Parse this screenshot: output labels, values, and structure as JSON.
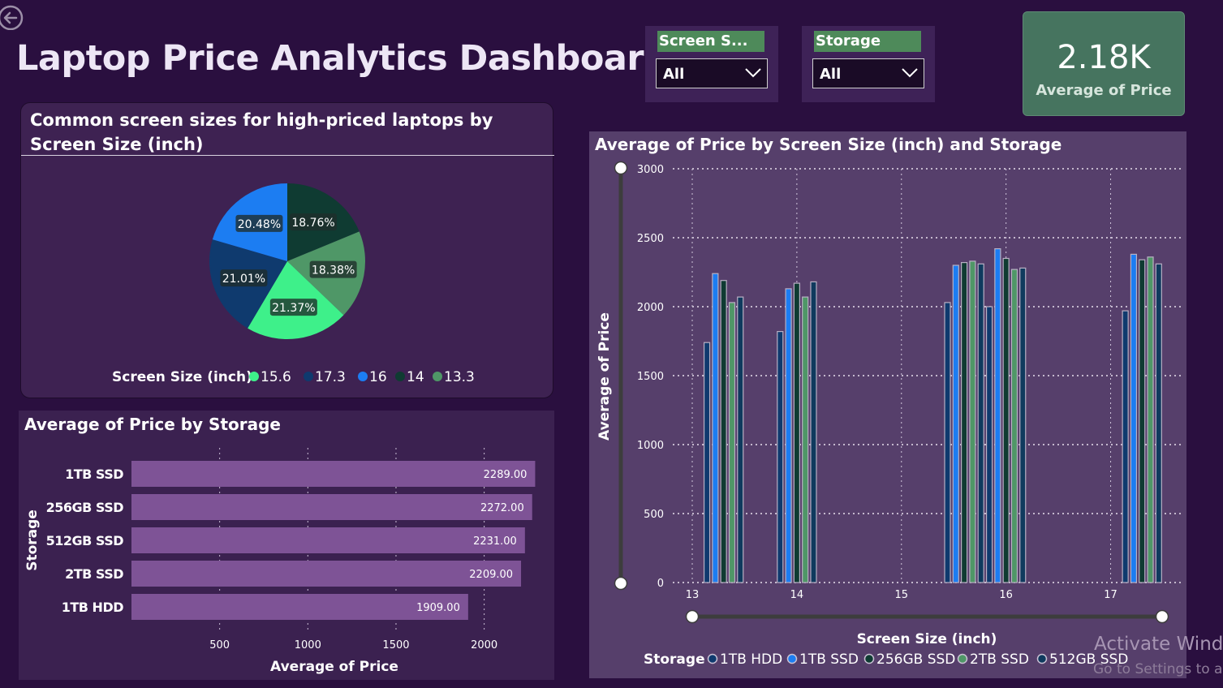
{
  "title": "Laptop Price Analytics Dashboard",
  "slicers": [
    {
      "label": "Screen S...",
      "value": "All"
    },
    {
      "label": "Storage",
      "value": "All"
    }
  ],
  "kpi": {
    "value": "2.18K",
    "label": "Average of Price"
  },
  "watermark": {
    "line1": "Activate Windo",
    "line2": "Go to Settings to ac"
  },
  "colors": {
    "15.6": "#3ef08a",
    "17.3": "#0f3a6e",
    "16": "#1c7df2",
    "14": "#0f3b32",
    "13.3": "#4f9767",
    "1TB HDD": "#0f3a6e",
    "1TB SSD": "#1c7df2",
    "256GB SSD": "#0f3b32",
    "2TB SSD": "#4f9767",
    "512GB SSD": "#0f3a5e",
    "storage_bar": "#7e5396"
  },
  "chart_data": [
    {
      "type": "pie",
      "title": "Common screen sizes for high-priced laptops by Screen Size (inch)",
      "legend_title": "Screen Size (inch)",
      "legend_position": "bottom",
      "slices": [
        {
          "name": "14",
          "value": 18.76,
          "label": "18.76%"
        },
        {
          "name": "13.3",
          "value": 18.38,
          "label": "18.38%"
        },
        {
          "name": "15.6",
          "value": 21.37,
          "label": "21.37%"
        },
        {
          "name": "17.3",
          "value": 21.01,
          "label": "21.01%"
        },
        {
          "name": "16",
          "value": 20.48,
          "label": "20.48%"
        }
      ],
      "legend_order": [
        "15.6",
        "17.3",
        "16",
        "14",
        "13.3"
      ]
    },
    {
      "type": "bar",
      "orientation": "horizontal",
      "title": "Average of Price by Storage",
      "xlabel": "Average of Price",
      "ylabel": "Storage",
      "categories": [
        "1TB SSD",
        "256GB SSD",
        "512GB SSD",
        "2TB SSD",
        "1TB HDD"
      ],
      "values": [
        2289.0,
        2272.0,
        2231.0,
        2209.0,
        1909.0
      ],
      "value_labels": [
        "2289.00",
        "2272.00",
        "2231.00",
        "2209.00",
        "1909.00"
      ],
      "xticks": [
        500,
        1000,
        1500,
        2000
      ],
      "xlim": [
        0,
        2310
      ],
      "grid": true
    },
    {
      "type": "bar",
      "title": "Average of Price by Screen Size (inch) and Storage",
      "xlabel": "Screen Size (inch)",
      "ylabel": "Average of Price",
      "legend_title": "Storage",
      "legend_position": "bottom",
      "xticks": [
        13,
        14,
        15,
        16,
        17
      ],
      "yticks": [
        0,
        500,
        1000,
        1500,
        2000,
        2500,
        3000
      ],
      "xlim": [
        13,
        17.5
      ],
      "ylim": [
        0,
        3000
      ],
      "grid": true,
      "series": [
        {
          "name": "1TB HDD",
          "points": [
            {
              "x": 13.3,
              "y": 1740
            },
            {
              "x": 14,
              "y": 1820
            },
            {
              "x": 15.6,
              "y": 2030
            },
            {
              "x": 16,
              "y": 2000
            },
            {
              "x": 17.3,
              "y": 1970
            }
          ]
        },
        {
          "name": "1TB SSD",
          "points": [
            {
              "x": 13.3,
              "y": 2240
            },
            {
              "x": 14,
              "y": 2130
            },
            {
              "x": 15.6,
              "y": 2300
            },
            {
              "x": 16,
              "y": 2420
            },
            {
              "x": 17.3,
              "y": 2380
            }
          ]
        },
        {
          "name": "256GB SSD",
          "points": [
            {
              "x": 13.3,
              "y": 2190
            },
            {
              "x": 14,
              "y": 2170
            },
            {
              "x": 15.6,
              "y": 2320
            },
            {
              "x": 16,
              "y": 2350
            },
            {
              "x": 17.3,
              "y": 2340
            }
          ]
        },
        {
          "name": "2TB SSD",
          "points": [
            {
              "x": 13.3,
              "y": 2030
            },
            {
              "x": 14,
              "y": 2070
            },
            {
              "x": 15.6,
              "y": 2330
            },
            {
              "x": 16,
              "y": 2270
            },
            {
              "x": 17.3,
              "y": 2360
            }
          ]
        },
        {
          "name": "512GB SSD",
          "points": [
            {
              "x": 13.3,
              "y": 2070
            },
            {
              "x": 14,
              "y": 2180
            },
            {
              "x": 15.6,
              "y": 2310
            },
            {
              "x": 16,
              "y": 2280
            },
            {
              "x": 17.3,
              "y": 2310
            }
          ]
        }
      ]
    }
  ]
}
